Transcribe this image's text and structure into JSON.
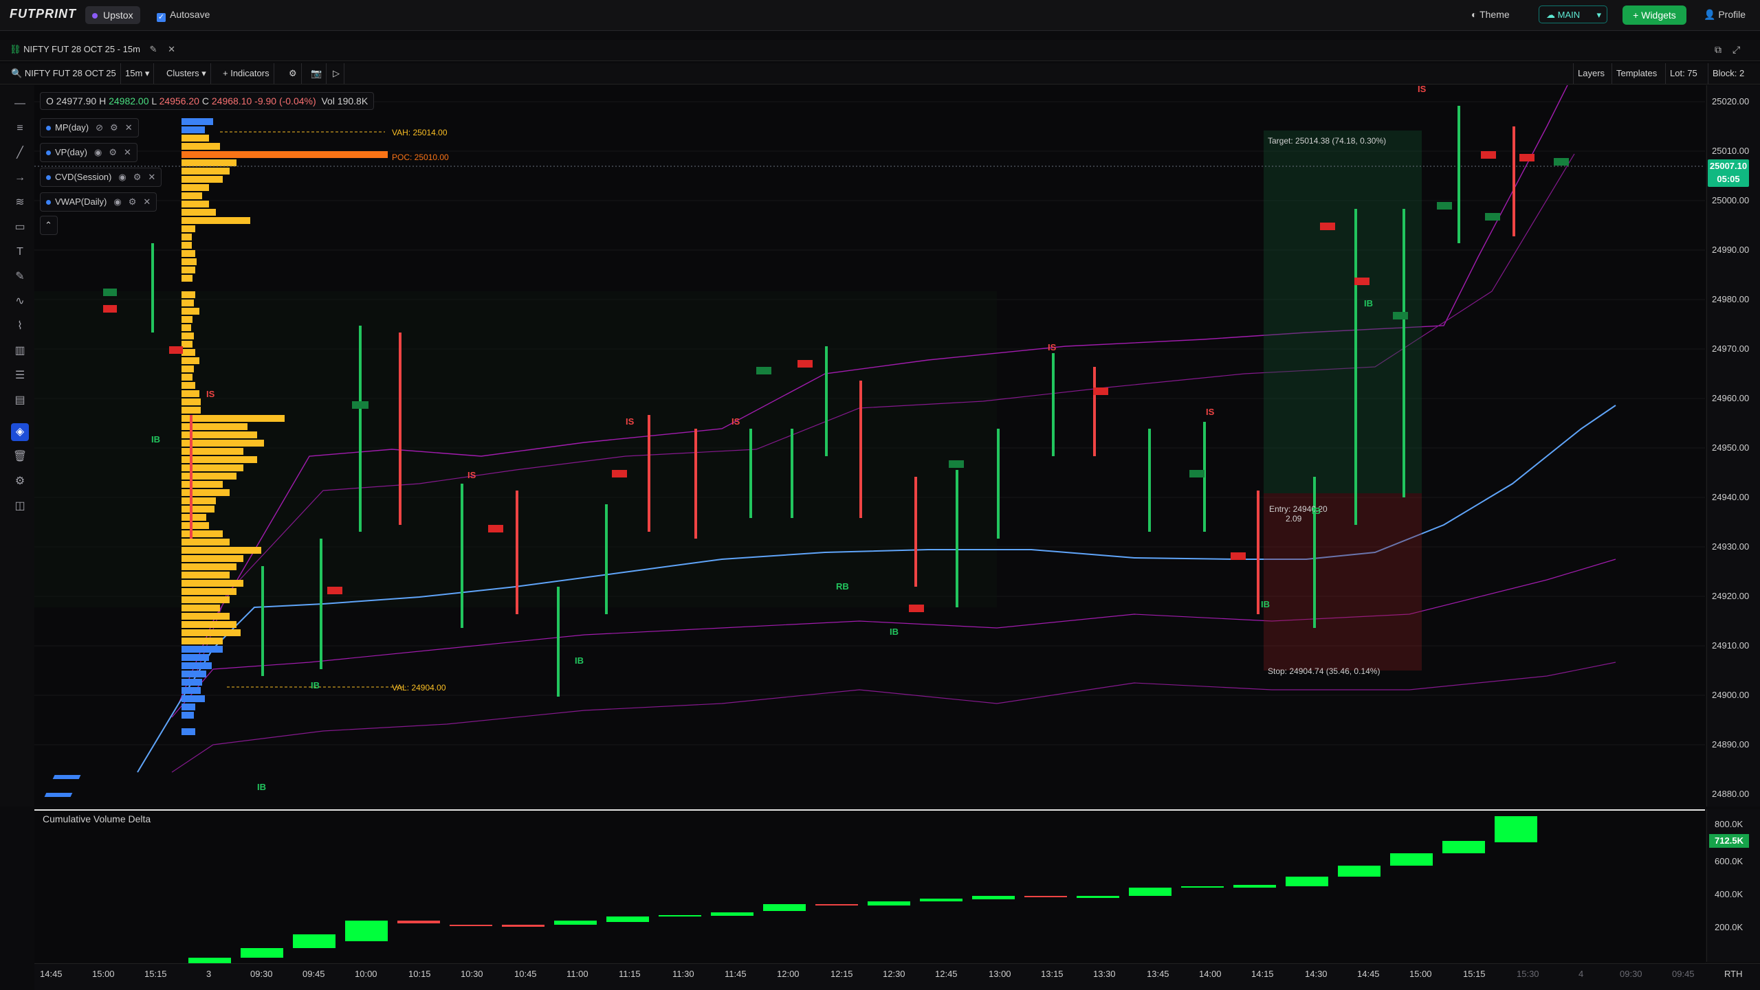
{
  "topbar": {
    "logo": "FUTPRINT",
    "broker": "Upstox",
    "autosave_label": "Autosave",
    "theme_label": "Theme",
    "layout_select": "MAIN",
    "widgets_label": "+ Widgets",
    "profile_label": "Profile"
  },
  "tab": {
    "title": "NIFTY FUT 28 OCT 25 - 15m"
  },
  "toolbar": {
    "symbol": "NIFTY FUT 28 OCT 25",
    "timeframe": "15m",
    "chart_type": "Clusters",
    "indicators_label": "+ Indicators",
    "layers_label": "Layers",
    "templates_label": "Templates",
    "lot_label": "Lot: 75",
    "block_label": "Block: 2"
  },
  "ohlc": {
    "o": "24977.90",
    "h_label": "H",
    "h": "24982.00",
    "l_label": "L",
    "l": "24956.20",
    "c_label": "C",
    "c": "24968.10",
    "chg": "-9.90 (-0.04%)",
    "vol_label": "Vol",
    "vol": "190.8K"
  },
  "indicators": [
    {
      "name": "MP(day)"
    },
    {
      "name": "VP(day)"
    },
    {
      "name": "CVD(Session)"
    },
    {
      "name": "VWAP(Daily)"
    }
  ],
  "annotations": {
    "vah": "VAH: 25014.00",
    "poc": "POC: 25010.00",
    "val": "VAL: 24904.00",
    "target": "Target: 25014.38 (74.18, 0.30%)",
    "entry": "Entry: 24940.20",
    "entry_sub": "2.09",
    "stop": "Stop: 24904.74 (35.46, 0.14%)"
  },
  "markers": {
    "ib": "IB",
    "is": "IS",
    "rb": "RB"
  },
  "price_axis": {
    "labels": [
      "25020.00",
      "25010.00",
      "25000.00",
      "24990.00",
      "24980.00",
      "24970.00",
      "24960.00",
      "24950.00",
      "24940.00",
      "24930.00",
      "24920.00",
      "24910.00",
      "24900.00",
      "24890.00",
      "24880.00"
    ],
    "current_price": "25007.10",
    "countdown": "05:05"
  },
  "cvd": {
    "title": "Cumulative Volume Delta",
    "axis_labels": [
      "800.0K",
      "600.0K",
      "400.0K",
      "200.0K"
    ],
    "current": "712.5K"
  },
  "time_axis": {
    "labels": [
      "14:45",
      "15:00",
      "15:15",
      "3",
      "09:30",
      "09:45",
      "10:00",
      "10:15",
      "10:30",
      "10:45",
      "11:00",
      "11:15",
      "11:30",
      "11:45",
      "12:00",
      "12:15",
      "12:30",
      "12:45",
      "13:00",
      "13:15",
      "13:30",
      "13:45",
      "14:00",
      "14:15",
      "14:30",
      "14:45",
      "15:00",
      "15:15"
    ],
    "future_labels": [
      "15:30",
      "4",
      "09:30",
      "09:45"
    ],
    "session": "RTH"
  },
  "colors": {
    "up": "#22c55e",
    "down": "#ef4444",
    "profile": "#fbbf24",
    "poc": "#f97316",
    "vwap": "#60a5fa",
    "band": "#a21caf"
  }
}
